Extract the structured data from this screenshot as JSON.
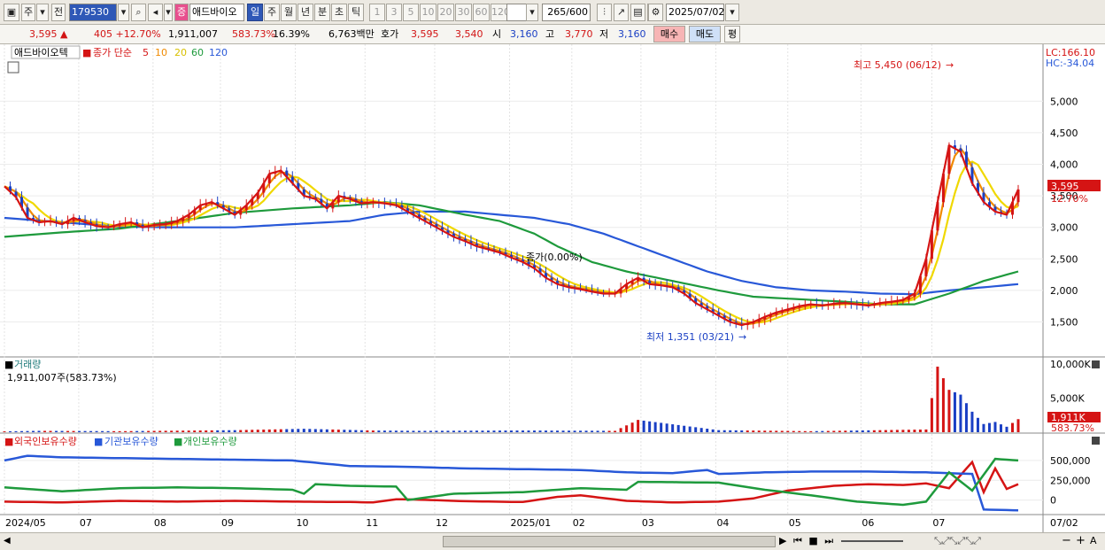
{
  "toolbar": {
    "mode": "주",
    "mode2": "전",
    "code": "179530",
    "stock_name": "애드바이오",
    "badge": "증",
    "periods": [
      "일",
      "주",
      "월",
      "년",
      "분",
      "초",
      "틱"
    ],
    "active_period": "일",
    "intervals": [
      "1",
      "3",
      "5",
      "10",
      "20",
      "30",
      "60",
      "120"
    ],
    "count": "265",
    "total": "/600",
    "date": "2025/07/02"
  },
  "quote": {
    "price": "3,595",
    "change": "405",
    "change_pct": "+12.70%",
    "volume": "1,911,007",
    "vol_ratio": "583.73%",
    "turnover": "16.39%",
    "amount": "6,763백만",
    "bid_label": "호가",
    "bid": "3,595",
    "ask": "3,540",
    "open_label": "시",
    "open": "3,160",
    "high_label": "고",
    "high": "3,770",
    "low_label": "저",
    "low": "3,160",
    "buy_label": "매수",
    "sell_label": "매도",
    "avg_label": "평"
  },
  "price_panel": {
    "title": "애드바이오텍",
    "ma_label": "종가 단순",
    "ma_periods": [
      "5",
      "10",
      "20",
      "60",
      "120"
    ],
    "ma_colors": [
      "#d51414",
      "#f08a00",
      "#f0d800",
      "#1e9a3c",
      "#2858d8"
    ],
    "lc": "LC:166.10",
    "hc": "HC:-34.04",
    "high_note": "최고 5,450 (06/12)",
    "low_note": "최저 1,351 (03/21)",
    "mid_note": "종가(0.00%)",
    "price_tag": "3,595",
    "pct_tag": "12.70%"
  },
  "volume_panel": {
    "title": "거래량",
    "value": "1,911,007주(583.73%)",
    "tag": "1,911K",
    "tag_pct": "583.73%"
  },
  "holding_panel": {
    "series": [
      "외국인보유수량",
      "기관보유수량",
      "개인보유수량"
    ],
    "colors": [
      "#d51414",
      "#2858d8",
      "#1e9a3c"
    ]
  },
  "chart_data": {
    "type": "line",
    "price_axis": {
      "ticks": [
        "5,000",
        "4,500",
        "4,000",
        "3,500",
        "3,000",
        "2,500",
        "2,000",
        "1,500"
      ],
      "min": 1100,
      "max": 5650
    },
    "volume_axis": {
      "ticks": [
        "10,000K",
        "5,000K"
      ],
      "max": 10500000
    },
    "holding_axis": {
      "ticks": [
        "500,000",
        "250,000",
        "0"
      ],
      "min": -150000,
      "max": 600000
    },
    "x_labels": [
      "2024/05",
      "07",
      "08",
      "09",
      "10",
      "11",
      "12",
      "2025/01",
      "02",
      "03",
      "04",
      "05",
      "06",
      "07"
    ],
    "x_end_label": "07/02",
    "close": [
      [
        0,
        3650
      ],
      [
        2,
        3480
      ],
      [
        4,
        3150
      ],
      [
        6,
        3080
      ],
      [
        8,
        3100
      ],
      [
        10,
        3050
      ],
      [
        12,
        3150
      ],
      [
        14,
        3080
      ],
      [
        16,
        3020
      ],
      [
        18,
        3000
      ],
      [
        20,
        3050
      ],
      [
        22,
        3080
      ],
      [
        24,
        3000
      ],
      [
        26,
        3040
      ],
      [
        28,
        3050
      ],
      [
        30,
        3100
      ],
      [
        32,
        3200
      ],
      [
        34,
        3350
      ],
      [
        36,
        3400
      ],
      [
        38,
        3300
      ],
      [
        40,
        3200
      ],
      [
        42,
        3350
      ],
      [
        44,
        3550
      ],
      [
        46,
        3850
      ],
      [
        48,
        3900
      ],
      [
        50,
        3700
      ],
      [
        52,
        3500
      ],
      [
        54,
        3450
      ],
      [
        56,
        3300
      ],
      [
        58,
        3500
      ],
      [
        60,
        3450
      ],
      [
        62,
        3380
      ],
      [
        64,
        3400
      ],
      [
        66,
        3380
      ],
      [
        68,
        3350
      ],
      [
        70,
        3250
      ],
      [
        72,
        3150
      ],
      [
        74,
        3050
      ],
      [
        76,
        2950
      ],
      [
        78,
        2850
      ],
      [
        80,
        2780
      ],
      [
        82,
        2700
      ],
      [
        84,
        2650
      ],
      [
        86,
        2600
      ],
      [
        88,
        2520
      ],
      [
        90,
        2450
      ],
      [
        92,
        2350
      ],
      [
        94,
        2200
      ],
      [
        96,
        2100
      ],
      [
        98,
        2050
      ],
      [
        100,
        2020
      ],
      [
        102,
        1980
      ],
      [
        104,
        1950
      ],
      [
        106,
        1950
      ],
      [
        108,
        2100
      ],
      [
        110,
        2200
      ],
      [
        112,
        2100
      ],
      [
        114,
        2080
      ],
      [
        116,
        2050
      ],
      [
        118,
        1950
      ],
      [
        120,
        1800
      ],
      [
        122,
        1700
      ],
      [
        124,
        1600
      ],
      [
        126,
        1500
      ],
      [
        128,
        1450
      ],
      [
        130,
        1500
      ],
      [
        132,
        1580
      ],
      [
        134,
        1650
      ],
      [
        136,
        1700
      ],
      [
        138,
        1750
      ],
      [
        140,
        1780
      ],
      [
        142,
        1760
      ],
      [
        144,
        1790
      ],
      [
        146,
        1800
      ],
      [
        148,
        1780
      ],
      [
        150,
        1760
      ],
      [
        152,
        1800
      ],
      [
        154,
        1820
      ],
      [
        156,
        1850
      ],
      [
        158,
        1950
      ],
      [
        160,
        2500
      ],
      [
        162,
        3400
      ],
      [
        164,
        4300
      ],
      [
        166,
        4200
      ],
      [
        168,
        3700
      ],
      [
        170,
        3400
      ],
      [
        172,
        3250
      ],
      [
        174,
        3200
      ],
      [
        176,
        3600
      ]
    ],
    "ma60": [
      [
        0,
        2850
      ],
      [
        10,
        2920
      ],
      [
        20,
        2980
      ],
      [
        30,
        3100
      ],
      [
        40,
        3230
      ],
      [
        50,
        3300
      ],
      [
        60,
        3350
      ],
      [
        66,
        3400
      ],
      [
        72,
        3350
      ],
      [
        80,
        3200
      ],
      [
        86,
        3100
      ],
      [
        92,
        2900
      ],
      [
        96,
        2700
      ],
      [
        102,
        2450
      ],
      [
        108,
        2300
      ],
      [
        116,
        2150
      ],
      [
        124,
        2000
      ],
      [
        130,
        1900
      ],
      [
        138,
        1860
      ],
      [
        146,
        1820
      ],
      [
        152,
        1780
      ],
      [
        158,
        1780
      ],
      [
        164,
        1950
      ],
      [
        170,
        2150
      ],
      [
        176,
        2300
      ]
    ],
    "ma120": [
      [
        0,
        3150
      ],
      [
        10,
        3080
      ],
      [
        20,
        3010
      ],
      [
        30,
        3000
      ],
      [
        40,
        3000
      ],
      [
        50,
        3050
      ],
      [
        60,
        3100
      ],
      [
        66,
        3200
      ],
      [
        72,
        3250
      ],
      [
        80,
        3250
      ],
      [
        86,
        3200
      ],
      [
        92,
        3150
      ],
      [
        98,
        3050
      ],
      [
        104,
        2900
      ],
      [
        110,
        2700
      ],
      [
        116,
        2500
      ],
      [
        122,
        2300
      ],
      [
        128,
        2150
      ],
      [
        134,
        2050
      ],
      [
        140,
        2000
      ],
      [
        146,
        1980
      ],
      [
        152,
        1950
      ],
      [
        158,
        1940
      ],
      [
        164,
        2000
      ],
      [
        170,
        2050
      ],
      [
        176,
        2100
      ]
    ],
    "volume": [
      [
        0,
        120000
      ],
      [
        6,
        200000
      ],
      [
        20,
        150000
      ],
      [
        40,
        300000
      ],
      [
        52,
        500000
      ],
      [
        64,
        250000
      ],
      [
        72,
        200000
      ],
      [
        90,
        250000
      ],
      [
        106,
        200000
      ],
      [
        110,
        1800000
      ],
      [
        124,
        300000
      ],
      [
        140,
        150000
      ],
      [
        160,
        400000
      ],
      [
        162,
        9600000
      ],
      [
        164,
        6200000
      ],
      [
        166,
        5500000
      ],
      [
        168,
        3000000
      ],
      [
        170,
        1200000
      ],
      [
        172,
        1500000
      ],
      [
        174,
        800000
      ],
      [
        176,
        1911007
      ]
    ],
    "foreign": [
      [
        0,
        -20000
      ],
      [
        10,
        -30000
      ],
      [
        20,
        -10000
      ],
      [
        30,
        -20000
      ],
      [
        40,
        -10000
      ],
      [
        50,
        -20000
      ],
      [
        60,
        -25000
      ],
      [
        64,
        -30000
      ],
      [
        68,
        10000
      ],
      [
        72,
        5000
      ],
      [
        80,
        -15000
      ],
      [
        90,
        -25000
      ],
      [
        96,
        40000
      ],
      [
        100,
        60000
      ],
      [
        108,
        -10000
      ],
      [
        116,
        -30000
      ],
      [
        124,
        -20000
      ],
      [
        130,
        20000
      ],
      [
        136,
        120000
      ],
      [
        144,
        180000
      ],
      [
        150,
        200000
      ],
      [
        156,
        190000
      ],
      [
        160,
        210000
      ],
      [
        164,
        150000
      ],
      [
        168,
        480000
      ],
      [
        170,
        100000
      ],
      [
        172,
        400000
      ],
      [
        174,
        140000
      ],
      [
        176,
        200000
      ]
    ],
    "institution": [
      [
        0,
        500000
      ],
      [
        4,
        560000
      ],
      [
        10,
        540000
      ],
      [
        20,
        530000
      ],
      [
        30,
        520000
      ],
      [
        40,
        510000
      ],
      [
        50,
        500000
      ],
      [
        60,
        430000
      ],
      [
        70,
        420000
      ],
      [
        80,
        400000
      ],
      [
        90,
        390000
      ],
      [
        100,
        380000
      ],
      [
        108,
        350000
      ],
      [
        116,
        340000
      ],
      [
        122,
        380000
      ],
      [
        124,
        330000
      ],
      [
        132,
        350000
      ],
      [
        140,
        360000
      ],
      [
        150,
        360000
      ],
      [
        160,
        350000
      ],
      [
        168,
        330000
      ],
      [
        170,
        -120000
      ],
      [
        176,
        -130000
      ]
    ],
    "individual": [
      [
        0,
        160000
      ],
      [
        10,
        110000
      ],
      [
        20,
        150000
      ],
      [
        30,
        160000
      ],
      [
        40,
        150000
      ],
      [
        50,
        130000
      ],
      [
        52,
        80000
      ],
      [
        54,
        200000
      ],
      [
        60,
        180000
      ],
      [
        68,
        170000
      ],
      [
        70,
        0
      ],
      [
        78,
        80000
      ],
      [
        90,
        100000
      ],
      [
        100,
        150000
      ],
      [
        108,
        130000
      ],
      [
        110,
        230000
      ],
      [
        124,
        220000
      ],
      [
        132,
        130000
      ],
      [
        140,
        60000
      ],
      [
        148,
        -20000
      ],
      [
        156,
        -60000
      ],
      [
        160,
        -20000
      ],
      [
        164,
        350000
      ],
      [
        168,
        120000
      ],
      [
        172,
        520000
      ],
      [
        176,
        500000
      ]
    ]
  },
  "bottom": {
    "zoom_minus": "−",
    "zoom_plus": "+",
    "axis": "A"
  }
}
